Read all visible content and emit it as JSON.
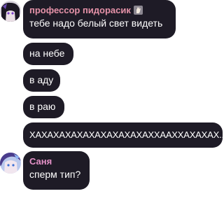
{
  "messages": [
    {
      "sender": "профессор пидорасик",
      "sender_emoji": "hand-emoji",
      "text": "тебе надо белый свет видеть",
      "avatar": "anime-avatar-dark"
    },
    {
      "text": "на небе"
    },
    {
      "text": "в аду"
    },
    {
      "text": "в раю"
    },
    {
      "text": "ХАХАХАХАХАХАХАХАХАХАХХААХХАХАХАХ..."
    },
    {
      "sender": "Саня",
      "text": "сперм тип?",
      "avatar": "anime-avatar-blue"
    }
  ],
  "colors": {
    "bubble": "#1e1b26",
    "text": "#ffffff",
    "sender_prof": "#e592a8",
    "sender_sanya": "#e592c8",
    "background": "#ffffff"
  }
}
